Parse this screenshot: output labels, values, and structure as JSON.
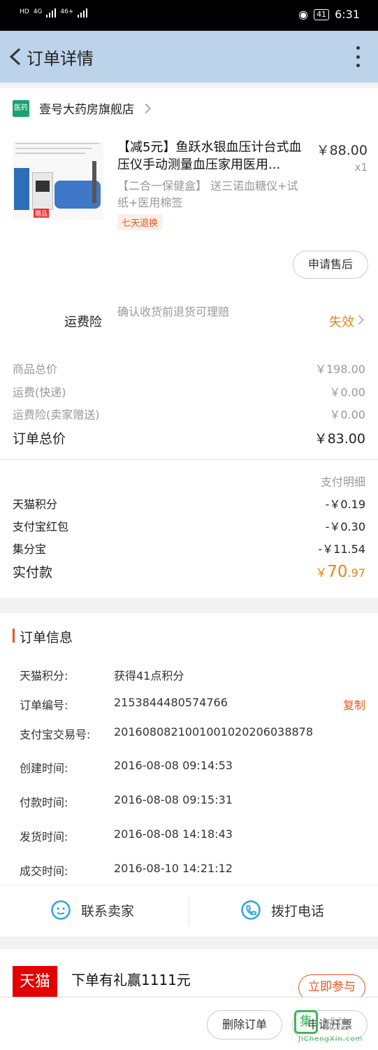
{
  "status_bar": {
    "left_labels": [
      "HD",
      "4G",
      "46+",
      "HD"
    ],
    "battery": "41",
    "time": "6:31"
  },
  "nav": {
    "title": "订单详情"
  },
  "shop": {
    "logo_text": "医药",
    "name": "壹号大药房旗舰店"
  },
  "product": {
    "title": "【减5元】鱼跃水银血压计台式血压仪手动测量血压家用医用...",
    "subtitle": "【二合一保健盒】 送三诺血糖仪+试纸+医用棉签",
    "price": "￥88.00",
    "qty": "x1",
    "tag": "七天退换",
    "thumb_badge": "赠品",
    "after_sale_button": "申请售后"
  },
  "shipping_insurance": {
    "label": "运费险",
    "desc": "确认收货前退货可理赔",
    "status": "失效"
  },
  "summary": {
    "goods_total_label": "商品总价",
    "goods_total": "￥198.00",
    "shipping_label": "运费(快递)",
    "shipping": "￥0.00",
    "insurance_label": "运费险(卖家赠送)",
    "insurance": "￥0.00",
    "order_total_label": "订单总价",
    "order_total": "￥83.00"
  },
  "payment": {
    "detail_label": "支付明细",
    "items": [
      {
        "label": "天猫积分",
        "amount": "-￥0.19"
      },
      {
        "label": "支付宝红包",
        "amount": "-￥0.30"
      },
      {
        "label": "集分宝",
        "amount": "-￥11.54"
      }
    ],
    "actual_label": "实付款",
    "actual_currency": "￥",
    "actual_int": "70",
    "actual_dec": ".97"
  },
  "order_info": {
    "title": "订单信息",
    "rows": [
      {
        "key": "天猫积分:",
        "value": "获得41点积分"
      },
      {
        "key": "订单编号:",
        "value": "2153844480574766"
      },
      {
        "key": "支付宝交易号:",
        "value": "2016080821001001020206038878"
      },
      {
        "key": "创建时间:",
        "value": "2016-08-08 09:14:53"
      },
      {
        "key": "付款时间:",
        "value": "2016-08-08 09:15:31"
      },
      {
        "key": "发货时间:",
        "value": "2016-08-08 14:18:43"
      },
      {
        "key": "成交时间:",
        "value": "2016-08-10 14:21:12"
      }
    ],
    "copy_label": "复制",
    "contact_seller": "联系卖家",
    "call_phone": "拨打电话"
  },
  "promo": {
    "logo_text": "天猫",
    "text": "下单有礼赢1111元",
    "join_button": "立即参与"
  },
  "bottom": {
    "delete_order": "删除订单",
    "invoice": "申请开票"
  },
  "watermark": {
    "icon": "集",
    "text": "诚信",
    "url": "JiChengXin.com"
  },
  "colors": {
    "accent": "#e5561f",
    "nav_bg": "#bcd3ea",
    "blue_icon": "#2aa4e8"
  }
}
